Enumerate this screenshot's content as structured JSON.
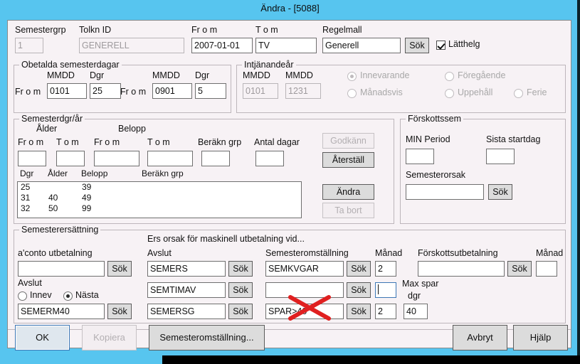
{
  "window": {
    "title": "Ändra - [5088]",
    "title_bar_color": "#57c5ef",
    "dialog_bg_color": "#f7f2f5"
  },
  "header": {
    "semestergrp_label": "Semestergrp",
    "semestergrp_value": "1",
    "tolkn_id_label": "Tolkn ID",
    "tolkn_id_value": "GENERELL",
    "from_label": "Fr o m",
    "from_value": "2007-01-01",
    "tom_label": "T o m",
    "tom_value": "TV",
    "regelmall_label": "Regelmall",
    "regelmall_value": "Generell",
    "regelmall_sok": "Sök",
    "latthelg_label": "Lätthelg",
    "latthelg_checked": true
  },
  "obetalda": {
    "group_title": "Obetalda semesterdagar",
    "mmdd_label_1": "MMDD",
    "dgr_label_1": "Dgr",
    "from_label_1": "Fr o m",
    "mmdd_value_1": "0101",
    "dgr_value_1": "25",
    "mmdd_label_2": "MMDD",
    "dgr_label_2": "Dgr",
    "from_label_2": "Fr o m",
    "mmdd_value_2": "0901",
    "dgr_value_2": "5"
  },
  "intjanandear": {
    "group_title": "Intjänandeår",
    "mmdd_label_1": "MMDD",
    "mmdd_label_2": "MMDD",
    "mmdd_value_1": "0101",
    "mmdd_value_2": "1231",
    "radios": [
      {
        "label": "Innevarande",
        "selected": true
      },
      {
        "label": "Föregående",
        "selected": false
      },
      {
        "label": "Månadsvis",
        "selected": false
      },
      {
        "label": "Uppehåll",
        "selected": false
      },
      {
        "label": "Ferie",
        "selected": false
      }
    ]
  },
  "semesterdgr": {
    "group_title": "Semesterdgr/år",
    "alder_label": "Ålder",
    "belopp_label": "Belopp",
    "alder_from_label": "Fr o m",
    "alder_tom_label": "T o m",
    "belopp_from_label": "Fr o m",
    "belopp_tom_label": "T o m",
    "berakn_grp_label": "Beräkn grp",
    "antal_dagar_label": "Antal dagar",
    "alder_from_value": "",
    "alder_tom_value": "",
    "belopp_from_value": "",
    "belopp_tom_value": "",
    "berakn_grp_value": "",
    "antal_dagar_value": "",
    "godkann_button": "Godkänn",
    "godkann_enabled": false,
    "aterstall_button": "Återställ",
    "andra_button": "Ändra",
    "ta_bort_button": "Ta bort",
    "ta_bort_enabled": false,
    "columns": [
      "Dgr",
      "Ålder",
      "Belopp",
      "Beräkn grp"
    ],
    "rows": [
      {
        "dgr": "25",
        "alder": "",
        "belopp": "39",
        "berakn": ""
      },
      {
        "dgr": "31",
        "alder": "40",
        "belopp": "49",
        "berakn": ""
      },
      {
        "dgr": "32",
        "alder": "50",
        "belopp": "99",
        "berakn": ""
      }
    ]
  },
  "forskottssem": {
    "group_title": "Förskottssem",
    "min_period_label": "MIN Period",
    "min_period_value": "",
    "sista_startdag_label": "Sista startdag",
    "sista_startdag_value": "",
    "semesterorsak_label": "Semesterorsak",
    "semesterorsak_value": "",
    "sok_button": "Sök"
  },
  "semesterersattning": {
    "group_title": "Semesterersättning",
    "ers_orsak_header": "Ers orsak för maskinell utbetalning vid...",
    "aconto_label": "a'conto utbetalning",
    "aconto_value": "",
    "aconto_sok": "Sök",
    "avslut_radio_label": "Avslut",
    "avslut_radios": [
      {
        "label": "Innev",
        "selected": false
      },
      {
        "label": "Nästa",
        "selected": true
      }
    ],
    "avslut_field_value": "SEMERM40",
    "avslut_field_sok": "Sök",
    "col_avslut_label": "Avslut",
    "col_semesteromstallning_label": "Semesteromställning",
    "col_manad_label_1": "Månad",
    "col_forskottsutbetalning_label": "Förskottsutbetalning",
    "col_manad_label_2": "Månad",
    "max_spar_label_1": "Max spar",
    "max_spar_label_2": "dgr",
    "avslut_rows": [
      {
        "value": "SEMERS",
        "sok": "Sök"
      },
      {
        "value": "SEMTIMAV",
        "sok": "Sök"
      },
      {
        "value": "SEMERSG",
        "sok": "Sök"
      }
    ],
    "omstallning_rows": [
      {
        "value": "SEMKVGAR",
        "sok": "Sök",
        "manad": "2",
        "crossed_out": false,
        "manad_focused": false
      },
      {
        "value": "",
        "sok": "Sök",
        "manad": "",
        "crossed_out": true,
        "manad_focused": true
      },
      {
        "value": "SPAR>40",
        "sok": "Sök",
        "manad": "2",
        "crossed_out": false,
        "manad_focused": false
      }
    ],
    "max_spar_dgr_value": "40",
    "forskottsutbetalning_value": "",
    "forskottsutbetalning_sok": "Sök",
    "forskottsutbetalning_manad": ""
  },
  "footer": {
    "ok_button": "OK",
    "kopiera_button": "Kopiera",
    "kopiera_enabled": false,
    "semesteromstallning_button": "Semesteromställning...",
    "avbryt_button": "Avbryt",
    "hjalp_button": "Hjälp"
  },
  "annotation": {
    "red_x_color": "#e02020"
  }
}
